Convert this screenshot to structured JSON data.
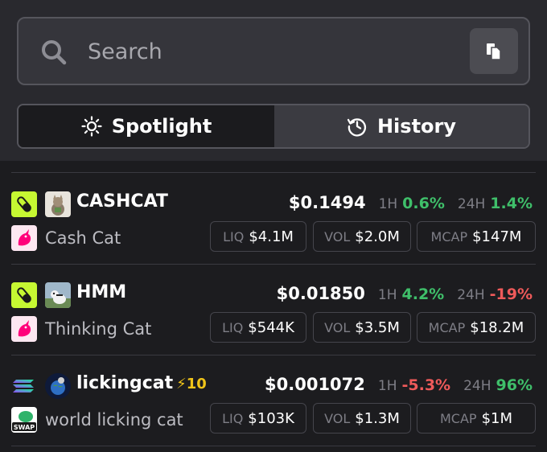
{
  "search": {
    "placeholder": "Search"
  },
  "tabs": [
    {
      "label": "Spotlight",
      "active": true,
      "icon": "sun-icon"
    },
    {
      "label": "History",
      "active": false,
      "icon": "history-icon"
    }
  ],
  "tokens": [
    {
      "symbol": "CASHCAT",
      "name": "Cash Cat",
      "boost": "",
      "chain_icon": "pump-icon",
      "dex_icon": "unicorn-icon",
      "price": "$0.1494",
      "h1_label": "1H",
      "h1": "0.6%",
      "h1_dir": "up",
      "h24_label": "24H",
      "h24": "1.4%",
      "h24_dir": "up",
      "liq_label": "LIQ",
      "liq": "$4.1M",
      "vol_label": "VOL",
      "vol": "$2.0M",
      "mcap_label": "MCAP",
      "mcap": "$147M"
    },
    {
      "symbol": "HMM",
      "name": "Thinking Cat",
      "boost": "",
      "chain_icon": "pump-icon",
      "dex_icon": "unicorn-icon",
      "price": "$0.01850",
      "h1_label": "1H",
      "h1": "4.2%",
      "h1_dir": "up",
      "h24_label": "24H",
      "h24": "-19%",
      "h24_dir": "down",
      "liq_label": "LIQ",
      "liq": "$544K",
      "vol_label": "VOL",
      "vol": "$3.5M",
      "mcap_label": "MCAP",
      "mcap": "$18.2M"
    },
    {
      "symbol": "lickingcat",
      "name": "world licking cat",
      "boost": "⚡10",
      "chain_icon": "solana-icon",
      "dex_icon": "swap-icon",
      "price": "$0.001072",
      "h1_label": "1H",
      "h1": "-5.3%",
      "h1_dir": "down",
      "h24_label": "24H",
      "h24": "96%",
      "h24_dir": "up",
      "liq_label": "LIQ",
      "liq": "$103K",
      "vol_label": "VOL",
      "vol": "$1.3M",
      "mcap_label": "MCAP",
      "mcap": "$1M"
    }
  ],
  "swap_badge": "SWAP",
  "colors": {
    "up": "#3fbf6a",
    "down": "#ef5a5a",
    "boost": "#f0c419",
    "pump_bg": "#c6f832",
    "unicorn": "#ff007a",
    "background": "#1c1c1f"
  }
}
